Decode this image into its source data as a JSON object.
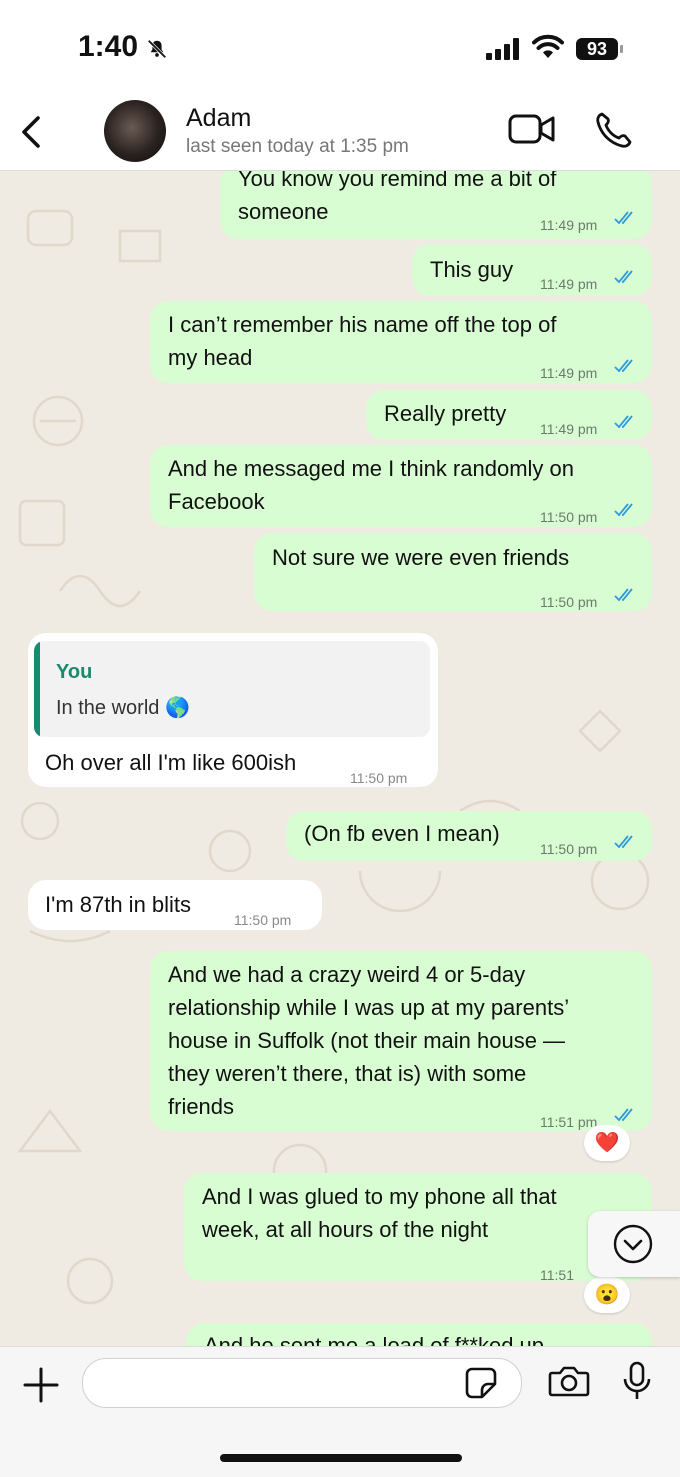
{
  "status_bar": {
    "time": "1:40",
    "battery": "93"
  },
  "header": {
    "contact_name": "Adam",
    "last_seen": "last seen today at 1:35 pm"
  },
  "messages": [
    {
      "dir": "out",
      "lines": [
        "You know you remind me a bit of",
        "someone"
      ],
      "time": "11:49 pm"
    },
    {
      "dir": "out",
      "lines": [
        "This guy"
      ],
      "time": "11:49 pm"
    },
    {
      "dir": "out",
      "lines": [
        "I can’t remember his name off the top of",
        "my head"
      ],
      "time": "11:49 pm"
    },
    {
      "dir": "out",
      "lines": [
        "Really pretty"
      ],
      "time": "11:49 pm"
    },
    {
      "dir": "out",
      "lines": [
        "And he messaged me I think randomly on",
        "Facebook"
      ],
      "time": "11:50 pm"
    },
    {
      "dir": "out",
      "lines": [
        "Not sure we were even friends"
      ],
      "time": "11:50 pm"
    },
    {
      "dir": "in",
      "quote_author": "You",
      "quote_text": "In the world 🌎",
      "lines": [
        "Oh over all I'm like 600ish"
      ],
      "time": "11:50 pm"
    },
    {
      "dir": "out",
      "lines": [
        "(On fb even I mean)"
      ],
      "time": "11:50 pm"
    },
    {
      "dir": "in",
      "lines": [
        "I'm 87th in blits"
      ],
      "time": "11:50 pm"
    },
    {
      "dir": "out",
      "lines": [
        "And we had a crazy weird 4 or 5-day",
        "relationship while I was up at my parents’",
        "house in Suffolk (not their main house —",
        "they weren’t there, that is) with some",
        "friends"
      ],
      "time": "11:51 pm",
      "reaction": "❤️"
    },
    {
      "dir": "out",
      "lines": [
        "And I was glued to my phone all that",
        "week, at all hours of the night"
      ],
      "time": "11:51",
      "reaction": "😮"
    },
    {
      "dir": "out",
      "lines": [
        "And he sent me a load of f**ked up"
      ],
      "time": ""
    }
  ],
  "input": {
    "placeholder": ""
  },
  "colors": {
    "outgoing_bubble": "#d9fdd3",
    "incoming_bubble": "#ffffff",
    "accent": "#1a8a6e",
    "read_ticks": "#2e9bdc",
    "background": "#efeae2"
  }
}
